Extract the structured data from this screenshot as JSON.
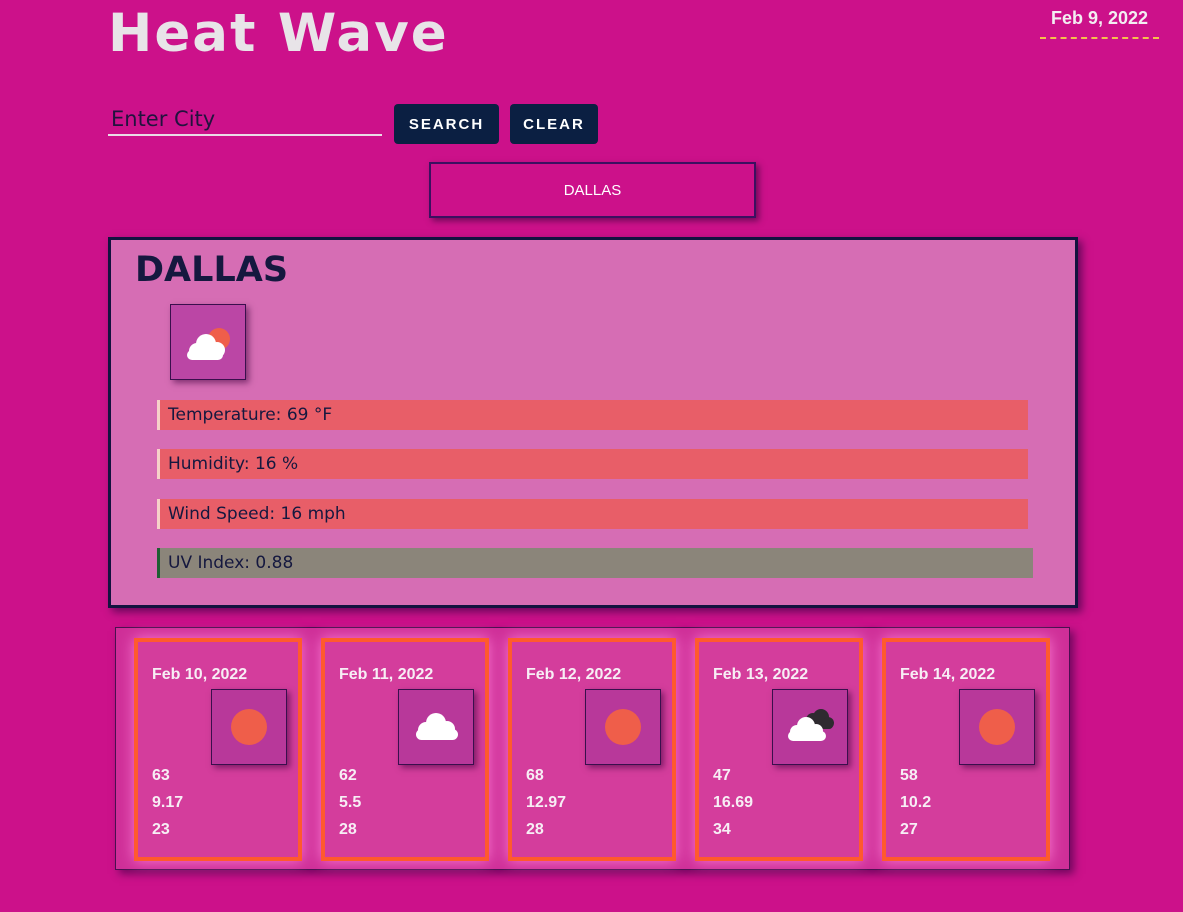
{
  "app": {
    "title": "Heat Wave",
    "date": "Feb 9, 2022"
  },
  "search": {
    "placeholder": "Enter City",
    "value": "",
    "search_label": "SEARCH",
    "clear_label": "CLEAR"
  },
  "history": [
    {
      "label": "DALLAS"
    }
  ],
  "current": {
    "city": "DALLAS",
    "icon": "sun-behind-cloud-icon",
    "temperature": "Temperature: 69 °F",
    "humidity": "Humidity: 16 %",
    "wind": "Wind Speed: 16 mph",
    "uv": "UV Index: 0.88"
  },
  "forecast": [
    {
      "date": "Feb 10, 2022",
      "icon": "sun-icon",
      "temp": "63",
      "wind": "9.17",
      "humidity": "23"
    },
    {
      "date": "Feb 11, 2022",
      "icon": "cloud-icon",
      "temp": "62",
      "wind": "5.5",
      "humidity": "28"
    },
    {
      "date": "Feb 12, 2022",
      "icon": "sun-icon",
      "temp": "68",
      "wind": "12.97",
      "humidity": "28"
    },
    {
      "date": "Feb 13, 2022",
      "icon": "dark-clouds-icon",
      "temp": "47",
      "wind": "16.69",
      "humidity": "34"
    },
    {
      "date": "Feb 14, 2022",
      "icon": "sun-icon",
      "temp": "58",
      "wind": "10.2",
      "humidity": "27"
    }
  ],
  "colors": {
    "background": "#cc118a",
    "button": "#0b1f42",
    "panel": "#d66db4",
    "stat_bar": "#e85e68",
    "uv_bar": "#8b857a",
    "card_border": "#ff5a2d",
    "sun": "#ef5e4a"
  }
}
